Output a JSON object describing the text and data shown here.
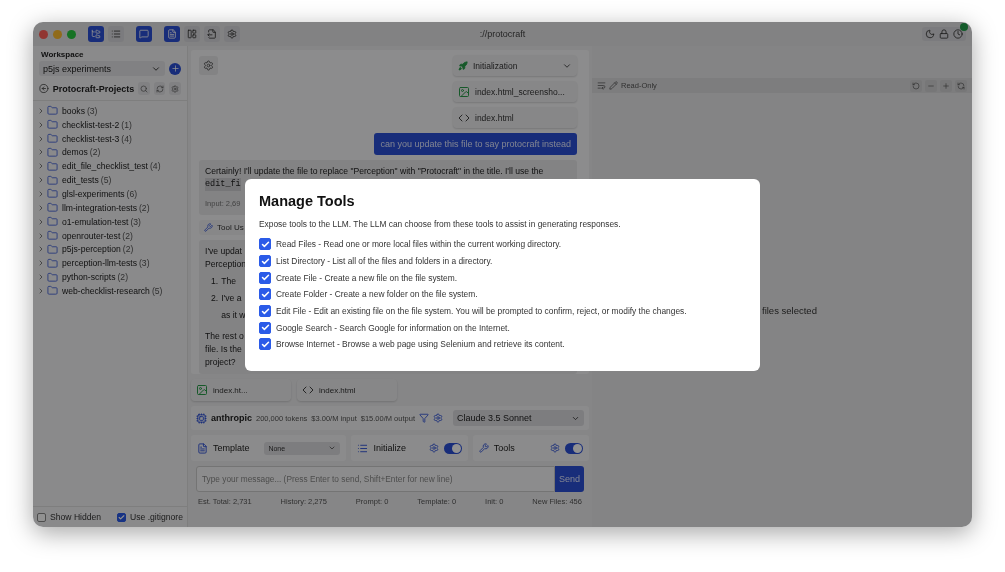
{
  "window": {
    "title": "://protocraft"
  },
  "toolbar": [
    {
      "kind": "tree",
      "selected": true
    },
    {
      "kind": "list",
      "selected": false
    },
    {
      "kind": "chat",
      "selected": true
    },
    {
      "kind": "file",
      "selected": true
    },
    {
      "kind": "layout",
      "selected": false
    },
    {
      "kind": "export",
      "selected": false
    },
    {
      "kind": "settings",
      "selected": false
    }
  ],
  "sidebar": {
    "workspace_label": "Workspace",
    "workspace": "p5js experiments",
    "root": "Protocraft-Projects",
    "folders": [
      {
        "name": "books",
        "count": "(3)"
      },
      {
        "name": "checklist-test-2",
        "count": "(1)"
      },
      {
        "name": "checklist-test-3",
        "count": "(4)"
      },
      {
        "name": "demos",
        "count": "(2)"
      },
      {
        "name": "edit_file_checklist_test",
        "count": "(4)"
      },
      {
        "name": "edit_tests",
        "count": "(5)"
      },
      {
        "name": "glsl-experiments",
        "count": "(6)"
      },
      {
        "name": "llm-integration-tests",
        "count": "(2)"
      },
      {
        "name": "o1-emulation-test",
        "count": "(3)"
      },
      {
        "name": "openrouter-test",
        "count": "(2)"
      },
      {
        "name": "p5js-perception",
        "count": "(2)"
      },
      {
        "name": "perception-llm-tests",
        "count": "(3)"
      },
      {
        "name": "python-scripts",
        "count": "(2)"
      },
      {
        "name": "web-checklist-research",
        "count": "(5)"
      }
    ],
    "options": [
      {
        "label": "Show Hidden",
        "checked": false
      },
      {
        "label": "Use .gitignore",
        "checked": true
      }
    ]
  },
  "chat": {
    "attachments": [
      {
        "kind": "initialization",
        "label": "Initialization"
      },
      {
        "kind": "image",
        "label": "index.html_screensho..."
      },
      {
        "kind": "code",
        "label": "index.html"
      }
    ],
    "user_message": "can you update this file to say protocraft instead",
    "assistant_reply": {
      "text": "Certainly! I'll update the file to replace \"Perception\" with \"Protocraft\" in the title. I'll use the",
      "code": "edit_fi",
      "meta": "Input: 2,69"
    },
    "tool_use": "Tool Us",
    "summary": {
      "lines": [
        "I've updat",
        "Perception"
      ],
      "items": [
        {
          "number": "1.",
          "lines": [
            "The"
          ]
        },
        {
          "number": "2.",
          "lines": [
            "I've a",
            "as it w"
          ]
        }
      ],
      "closing": [
        "The rest o",
        "file. Is the",
        "project?"
      ]
    }
  },
  "pending_files": [
    {
      "kind": "image",
      "label": "index.ht..."
    },
    {
      "kind": "code",
      "label": "index.html"
    }
  ],
  "model_bar": {
    "provider": "anthropic",
    "tokens": "200,000 tokens",
    "input_price": "$3.00/M input",
    "output_price": "$15.00/M output",
    "model": "Claude 3.5 Sonnet"
  },
  "settings": {
    "template": {
      "label": "Template",
      "value": "None"
    },
    "initialize": {
      "label": "Initialize",
      "on": true
    },
    "tools": {
      "label": "Tools",
      "on": true
    }
  },
  "composer": {
    "placeholder": "Type your message... (Press Enter to send, Shift+Enter for new line)",
    "send": "Send"
  },
  "stats": [
    "Est. Total: 2,731",
    "History: 2,275",
    "Prompt: 0",
    "Template: 0",
    "Init: 0",
    "New Files: 456"
  ],
  "editor": {
    "mode": "Read-Only",
    "empty_message": "files selected"
  },
  "modal": {
    "title": "Manage Tools",
    "description": "Expose tools to the LLM. The LLM can choose from these tools to assist in generating responses.",
    "tools": [
      {
        "label": "Read Files - Read one or more local files within the current working directory.",
        "checked": true
      },
      {
        "label": "List Directory - List all of the files and folders in a directory.",
        "checked": true
      },
      {
        "label": "Create File - Create a new file on the file system.",
        "checked": true
      },
      {
        "label": "Create Folder - Create a new folder on the file system.",
        "checked": true
      },
      {
        "label": "Edit File - Edit an existing file on the file system. You will be prompted to confirm, reject, or modify the changes.",
        "checked": true
      },
      {
        "label": "Google Search - Search Google for information on the Internet.",
        "checked": true
      },
      {
        "label": "Browse Internet - Browse a web page using Selenium and retrieve its content.",
        "checked": true
      }
    ]
  }
}
